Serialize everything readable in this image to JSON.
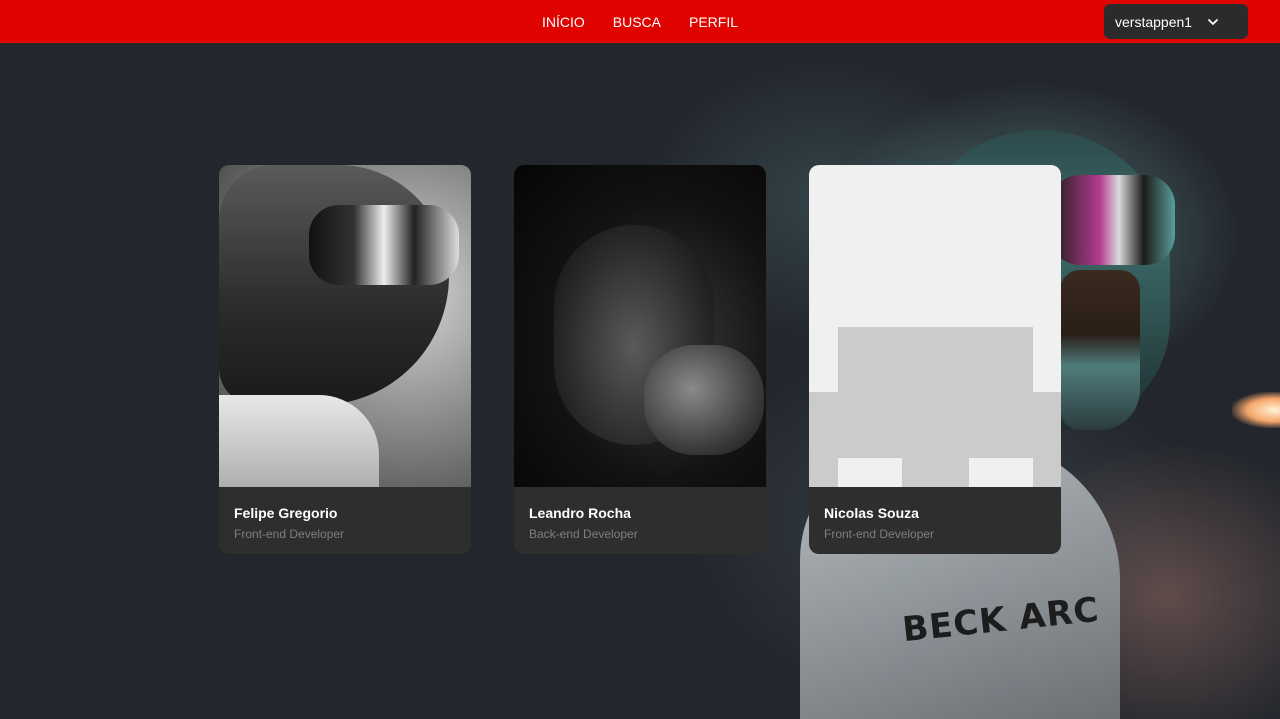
{
  "navbar": {
    "links": [
      {
        "label": "INÍCIO"
      },
      {
        "label": "BUSCA"
      },
      {
        "label": "PERFIL"
      }
    ],
    "user": {
      "username": "verstappen1",
      "icon": "chevron-down-icon"
    },
    "color": "#e00400"
  },
  "cards": [
    {
      "name": "Felipe Gregorio",
      "role": "Front-end Developer"
    },
    {
      "name": "Leandro Rocha",
      "role": "Back-end Developer"
    },
    {
      "name": "Nicolas Souza",
      "role": "Front-end Developer"
    }
  ],
  "background_art": {
    "logo_text": "BECK ARC"
  }
}
